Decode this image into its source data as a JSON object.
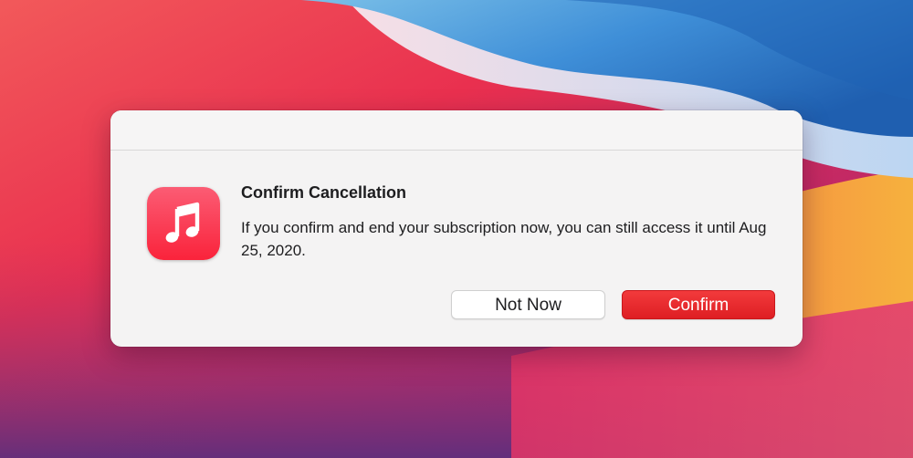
{
  "dialog": {
    "icon": "apple-music-icon",
    "title": "Confirm Cancellation",
    "message": "If you confirm and end your subscription now, you can still access it until Aug 25, 2020.",
    "buttons": {
      "secondary_label": "Not Now",
      "primary_label": "Confirm"
    }
  },
  "colors": {
    "primary_button": "#e42a2d",
    "icon_gradient_top": "#fb5c74",
    "icon_gradient_bottom": "#fa233b",
    "dialog_background": "#f4f3f3"
  }
}
